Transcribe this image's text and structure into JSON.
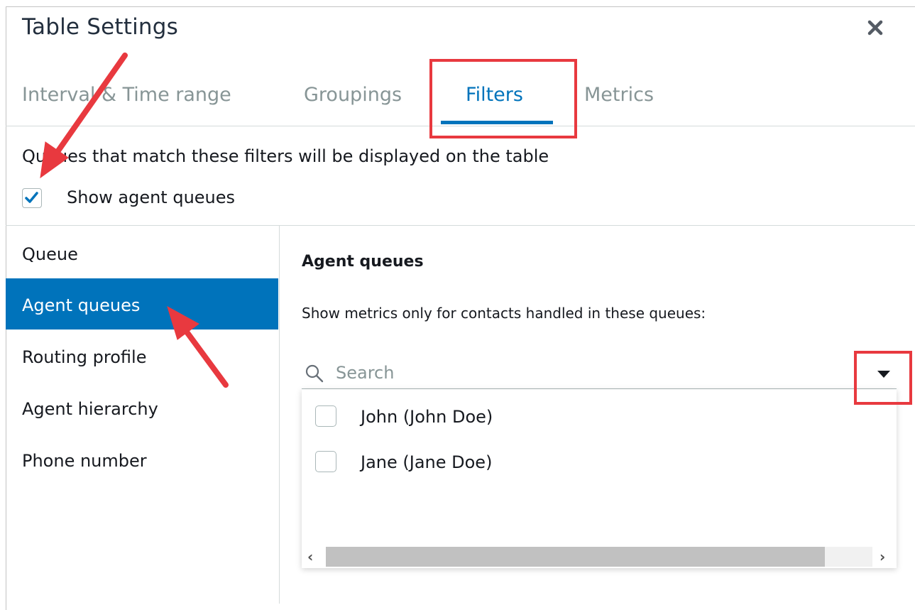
{
  "dialog": {
    "title": "Table Settings",
    "close_icon": "close-icon"
  },
  "tabs": [
    {
      "label": "Interval & Time range",
      "active": false
    },
    {
      "label": "Groupings",
      "active": false
    },
    {
      "label": "Filters",
      "active": true
    },
    {
      "label": "Metrics",
      "active": false
    }
  ],
  "filters": {
    "description": "Queues that match these filters will be displayed on the table",
    "show_agent_queues_label": "Show agent queues",
    "show_agent_queues_checked": true
  },
  "sidebar": {
    "items": [
      {
        "label": "Queue",
        "active": false
      },
      {
        "label": "Agent queues",
        "active": true
      },
      {
        "label": "Routing profile",
        "active": false
      },
      {
        "label": "Agent hierarchy",
        "active": false
      },
      {
        "label": "Phone number",
        "active": false
      }
    ]
  },
  "agent_queues": {
    "title": "Agent queues",
    "hint": "Show metrics only for contacts handled in these queues:",
    "search_placeholder": "Search",
    "search_value": "",
    "options": [
      {
        "label": "John (John Doe)",
        "checked": false
      },
      {
        "label": "Jane (Jane Doe)",
        "checked": false
      }
    ],
    "scrollbar_left_icon": "chevron-left-icon",
    "scrollbar_right_icon": "chevron-right-icon"
  },
  "colors": {
    "accent": "#0073bb",
    "annotation": "#e8393f",
    "title": "#232f3e"
  }
}
